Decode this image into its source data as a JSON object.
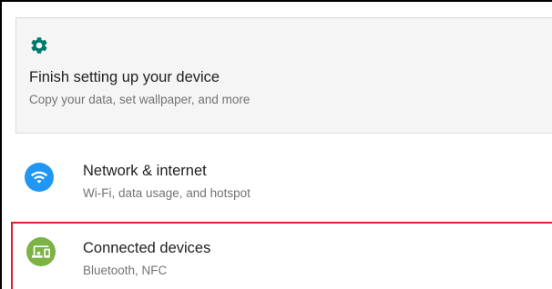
{
  "suggestion": {
    "title": "Finish setting up your device",
    "subtitle": "Copy your data, set wallpaper, and more",
    "icon": "gear-icon",
    "icon_color": "#00796b"
  },
  "settings": [
    {
      "title": "Network & internet",
      "subtitle": "Wi-Fi, data usage, and hotspot",
      "icon": "wifi-icon",
      "icon_color": "#2196f3"
    },
    {
      "title": "Connected devices",
      "subtitle": "Bluetooth, NFC",
      "icon": "connected-devices-icon",
      "icon_color": "#7cb342",
      "highlighted": true,
      "highlight_color": "#e0202a"
    }
  ]
}
